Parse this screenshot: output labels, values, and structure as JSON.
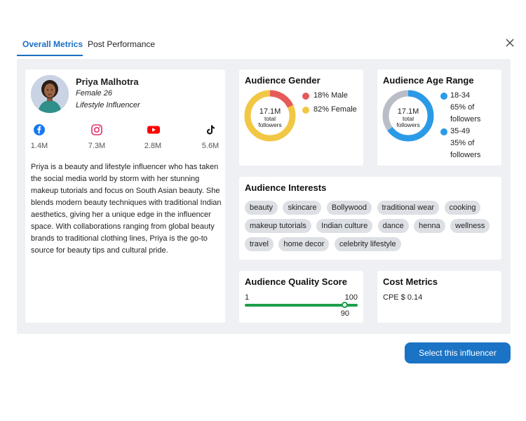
{
  "tabs": [
    {
      "label": "Overall Metrics",
      "active": true
    },
    {
      "label": "Post Performance",
      "active": false
    }
  ],
  "close_icon": "close-icon",
  "profile": {
    "name": "Priya Malhotra",
    "gender_age": "Female 26",
    "category": "Lifestyle Influencer",
    "socials": [
      {
        "platform": "facebook",
        "icon": "facebook-icon",
        "count": "1.4M",
        "color": "#1877f2"
      },
      {
        "platform": "instagram",
        "icon": "instagram-icon",
        "count": "7.3M",
        "color": "#e1306c"
      },
      {
        "platform": "youtube",
        "icon": "youtube-icon",
        "count": "2.8M",
        "color": "#ff0000"
      },
      {
        "platform": "tiktok",
        "icon": "tiktok-icon",
        "count": "5.6M",
        "color": "#111111"
      }
    ],
    "bio": "Priya is a beauty and lifestyle influencer who has taken the social media world by storm with her stunning makeup tutorials and focus on South Asian beauty. She blends modern beauty techniques with traditional Indian aesthetics, giving her a unique edge in the influencer space. With collaborations ranging from global beauty brands to traditional clothing lines, Priya is the go-to source for beauty tips and cultural pride."
  },
  "gender": {
    "title": "Audience Gender",
    "total": "17.1M",
    "total_label_1": "total",
    "total_label_2": "followers",
    "segments": [
      {
        "label": "18% Male",
        "percent": 18,
        "color": "#e65a5a"
      },
      {
        "label": "82% Female",
        "percent": 82,
        "color": "#f2c744"
      }
    ]
  },
  "age": {
    "title": "Audience Age Range",
    "total": "17.1M",
    "total_label_1": "total",
    "total_label_2": "followers",
    "segments": [
      {
        "range": "18-34",
        "line1": "65% of",
        "line2": "followers",
        "percent": 65,
        "color": "#2b9be8"
      },
      {
        "range": "35-49",
        "line1": "35% of",
        "line2": "followers",
        "percent": 35,
        "color": "#b9bec6"
      }
    ]
  },
  "interests": {
    "title": "Audience Interests",
    "chips": [
      "beauty",
      "skincare",
      "Bollywood",
      "traditional wear",
      "cooking",
      "makeup tutorials",
      "Indian culture",
      "dance",
      "henna",
      "wellness",
      "travel",
      "home decor",
      "celebrity lifestyle"
    ]
  },
  "quality": {
    "title": "Audience Quality Score",
    "min": "1",
    "max": "100",
    "value": "90",
    "accent": "#1e9e4a"
  },
  "cost": {
    "title": "Cost Metrics",
    "line": "CPE $ 0.14"
  },
  "select_button": "Select this influencer",
  "accent": "#1a73c4"
}
